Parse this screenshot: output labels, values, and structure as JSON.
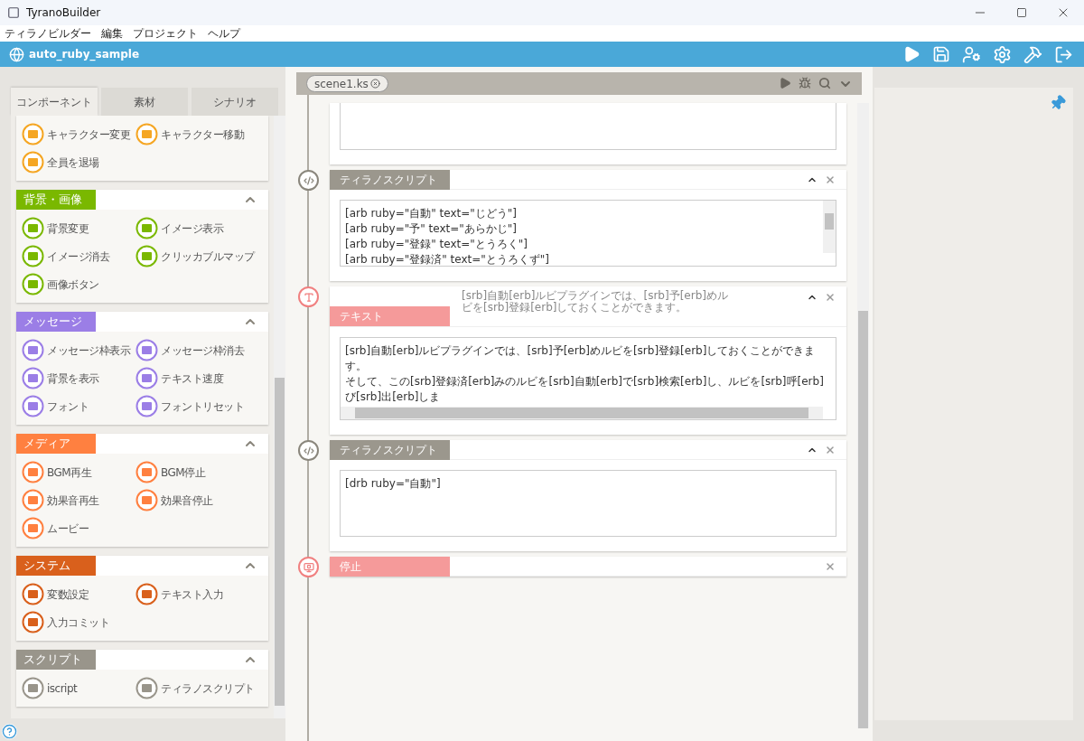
{
  "window": {
    "title": "TyranoBuilder"
  },
  "menu": [
    "ティラノビルダー",
    "編集",
    "プロジェクト",
    "ヘルプ"
  ],
  "project": {
    "name": "auto_ruby_sample"
  },
  "palette": {
    "tabs": [
      {
        "label": "コンポーネント",
        "selected": true
      },
      {
        "label": "素材",
        "selected": false
      },
      {
        "label": "シナリオ",
        "selected": false
      }
    ],
    "groups": [
      {
        "color": "#f5a623",
        "items": [
          "キャラクター変更",
          "キャラクター移動",
          "全員を退場"
        ]
      },
      {
        "title": "背景・画像",
        "color": "#7ab800",
        "items": [
          "背景変更",
          "イメージ表示",
          "イメージ消去",
          "クリッカブルマップ",
          "画像ボタン"
        ]
      },
      {
        "title": "メッセージ",
        "color": "#9b7ee6",
        "items": [
          "メッセージ枠表示",
          "メッセージ枠消去",
          "背景を表示",
          "テキスト速度",
          "フォント",
          "フォントリセット"
        ]
      },
      {
        "title": "メディア",
        "color": "#ff8040",
        "items": [
          "BGM再生",
          "BGM停止",
          "効果音再生",
          "効果音停止",
          "ムービー"
        ]
      },
      {
        "title": "システム",
        "color": "#d9601c",
        "items": [
          "変数設定",
          "テキスト入力",
          "入力コミット"
        ]
      },
      {
        "title": "スクリプト",
        "color": "#99958b",
        "items": [
          "iscript",
          "ティラノスクリプト"
        ]
      }
    ]
  },
  "editor": {
    "file_tab": "scene1.ks",
    "blocks": [
      {
        "kind": "continued"
      },
      {
        "kind": "script",
        "label": "ティラノスクリプト",
        "lines": [
          "[arb ruby=\"自動\" text=\"じどう\"]",
          "[arb ruby=\"予\" text=\"あらかじ\"]",
          "[arb ruby=\"登録\" text=\"とうろく\"]",
          "[arb ruby=\"登録済\" text=\"とうろくず\"]"
        ]
      },
      {
        "kind": "text",
        "label": "テキスト",
        "summary": "[srb]自動[erb]ルビプラグインでは、[srb]予[erb]めルビを[srb]登録[erb]しておくことができます。",
        "lines": [
          "[srb]自動[erb]ルビプラグインでは、[srb]予[erb]めルビを[srb]登録[erb]しておくことができます。",
          "そして、この[srb]登録済[erb]みのルビを[srb]自動[erb]で[srb]検索[erb]し、ルビを[srb]呼[erb]び[srb]出[erb]しま"
        ]
      },
      {
        "kind": "script",
        "label": "ティラノスクリプト",
        "lines": [
          "[drb ruby=\"自動\"]"
        ]
      },
      {
        "kind": "stop",
        "label": "停止"
      }
    ]
  }
}
